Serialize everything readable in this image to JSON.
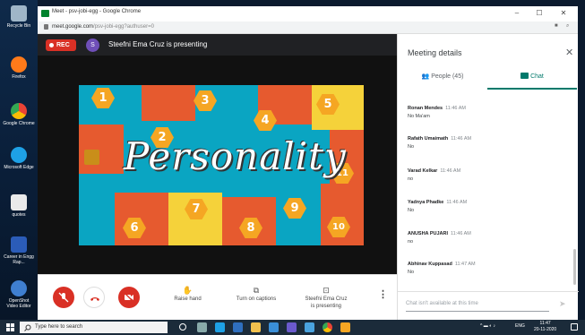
{
  "desktop": {
    "icons": [
      {
        "label": "Recycle Bin",
        "color": "#9fb6c8"
      },
      {
        "label": "Firefox",
        "color": "#ff7a1a"
      },
      {
        "label": "Google Chrome",
        "color": "#4caf50"
      },
      {
        "label": "Microsoft Edge",
        "color": "#1ea1e6"
      },
      {
        "label": "quotes",
        "color": "#eaeaea"
      },
      {
        "label": "Career in Engg Rap...",
        "color": "#2b5cb8"
      },
      {
        "label": "OpenShot Video Editor",
        "color": "#3f7fd0"
      }
    ]
  },
  "browser": {
    "tab_title": "Meet - psv-jobi-egg - Google Chrome",
    "url_host": "meet.google.com",
    "url_path": "/psv-jobi-egg?authuser=0"
  },
  "meet": {
    "rec_label": "REC",
    "presenter_initial": "S",
    "presenting_text": "Steefni Ema Cruz is presenting"
  },
  "slide": {
    "word": "Personality",
    "numbers": [
      "1",
      "2",
      "3",
      "4",
      "5",
      "6",
      "7",
      "8",
      "9",
      "10",
      "11"
    ]
  },
  "controls": {
    "raise_hand": "Raise hand",
    "captions": "Turn on captions",
    "presenting_line1": "Steefni Ema Cruz",
    "presenting_line2": "is presenting"
  },
  "panel": {
    "title": "Meeting details",
    "tab_people": "People (45)",
    "tab_chat": "Chat",
    "messages": [
      {
        "sender": "Ronan Mendes",
        "time": "11:46 AM",
        "text": "No Ma'am"
      },
      {
        "sender": "Rafath Umaimath",
        "time": "11:46 AM",
        "text": "No"
      },
      {
        "sender": "Varad Kelkar",
        "time": "11:46 AM",
        "text": "no"
      },
      {
        "sender": "Yadnya Phadke",
        "time": "11:46 AM",
        "text": "No"
      },
      {
        "sender": "ANUSHA PUJARI",
        "time": "11:46 AM",
        "text": "no"
      },
      {
        "sender": "Abhinav Kuppasad",
        "time": "11:47 AM",
        "text": "No"
      }
    ],
    "chat_placeholder": "Chat isn't available at this time"
  },
  "taskbar": {
    "search_placeholder": "Type here to search",
    "lang": "ENG",
    "time": "11:47",
    "date": "20-11-2020"
  },
  "colors": {
    "rec": "#d93025",
    "chat_accent": "#00796b",
    "hangup": "#d93025"
  }
}
